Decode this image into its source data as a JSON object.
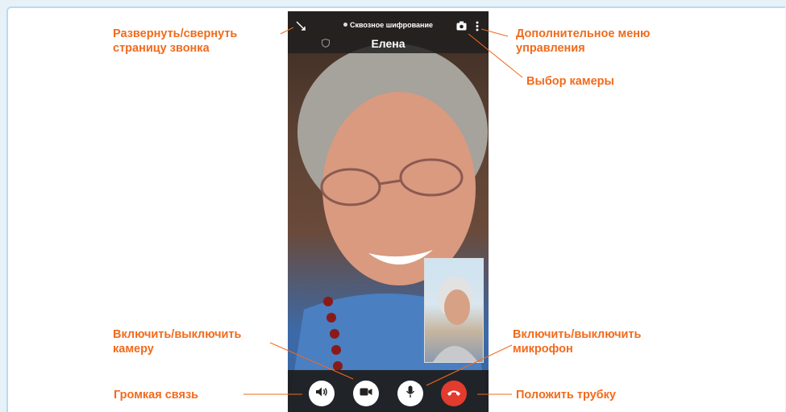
{
  "call": {
    "encryption_text": "Сквозное шифрование",
    "contact_name": "Елена"
  },
  "annotations": {
    "collapse": [
      "Развернуть/свернуть",
      "страницу звонка"
    ],
    "more_menu": [
      "Дополнительное меню",
      "управления"
    ],
    "camera_select": "Выбор камеры",
    "camera_toggle": [
      "Включить/выключить",
      "камеру"
    ],
    "mic_toggle": [
      "Включить/выключить",
      "микрофон"
    ],
    "speaker": "Громкая связь",
    "hangup": "Положить трубку"
  },
  "colors": {
    "annotation": "#f26a1b",
    "hangup": "#e33b2e",
    "bars": "#1e1e1e"
  },
  "icons": {
    "collapse": "collapse-arrows-icon",
    "camera_switch": "camera-icon",
    "menu": "vertical-dots-icon",
    "shield": "shield-icon",
    "speaker": "speaker-icon",
    "video": "video-camera-icon",
    "mic": "microphone-icon",
    "hangup": "phone-hangup-icon"
  }
}
